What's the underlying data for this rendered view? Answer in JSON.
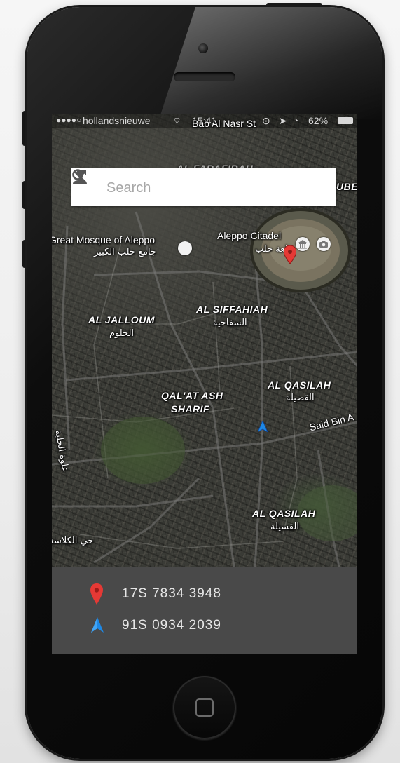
{
  "status_bar": {
    "carrier": "hollandsnieuwe",
    "time": "15:41",
    "battery": "62%"
  },
  "search": {
    "placeholder": "Search"
  },
  "map": {
    "labels": {
      "great_mosque": "Great Mosque of Aleppo",
      "great_mosque_ar": "جامع حلب الكبير",
      "citadel": "Aleppo Citadel",
      "citadel_ar": "قلعة حلب",
      "al_jalloum": "AL JALLOUM",
      "al_jalloum_ar": "الجلوم",
      "al_siffahiah": "AL SIFFAHIAH",
      "al_siffahiah_ar": "السفاحية",
      "al_qasilah_1": "AL QASILAH",
      "al_qasilah_1_ar": "القصيلة",
      "qalat_ash_sharif_1": "QAL'AT ASH",
      "qalat_ash_sharif_2": "SHARIF",
      "al_qasilah_2": "AL QASILAH",
      "al_qasilah_2_ar": "القسيلة",
      "said_bin": "Said Bin A",
      "top_street": "Bab Al Nasr St",
      "top_right_partial": "UBEI",
      "top_center_partial": "AL FARAFIRAH",
      "left_street_ar": "علوة الحلبة",
      "bottom_left_ar": "حي الكلاسة"
    }
  },
  "coordinates": [
    {
      "marker": "red-pin",
      "value": "17S 7834 3948"
    },
    {
      "marker": "blue-arrow",
      "value": "91S 0934 2039"
    }
  ],
  "colors": {
    "pin_red": "#e53935",
    "arrow_blue": "#1e88e5",
    "panel_bg": "#494949",
    "search_bg": "#ffffff"
  }
}
